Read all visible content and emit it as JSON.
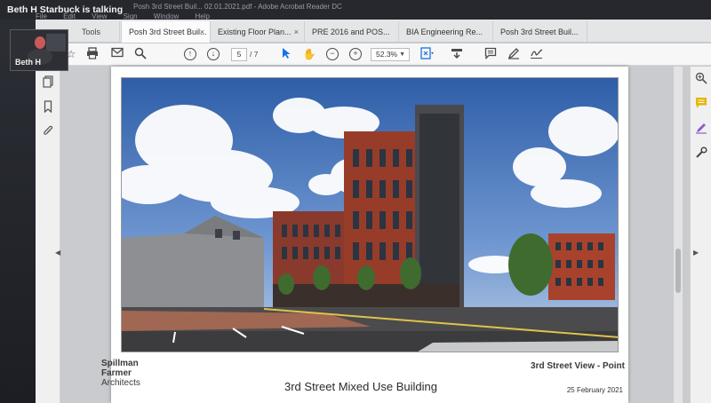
{
  "meeting": {
    "talking_label": "Beth H Starbuck is talking",
    "participant_name": "Beth H"
  },
  "window": {
    "title": "Posh 3rd Street Buil... 02.01.2021.pdf - Adobe Acrobat Reader DC",
    "menu": [
      "File",
      "Edit",
      "View",
      "Sign",
      "Window",
      "Help"
    ]
  },
  "tabs": {
    "tools": "Tools",
    "items": [
      {
        "label": "Posh 3rd Street Buil...",
        "active": true
      },
      {
        "label": "Existing Floor Plan...",
        "active": false
      },
      {
        "label": "PRE 2016 and POS...",
        "active": false
      },
      {
        "label": "BIA Engineering Re...",
        "active": false
      },
      {
        "label": "Posh 3rd Street Buil...",
        "active": false
      }
    ],
    "close_glyph": "×"
  },
  "toolbar": {
    "current_page": "5",
    "page_count": "/ 7",
    "zoom": "52.3%",
    "icons": [
      "star-icon",
      "print-icon",
      "mail-icon",
      "search-icon",
      "page-up-icon",
      "page-down-icon",
      "select-cursor-icon",
      "hand-icon",
      "zoom-out-icon",
      "zoom-in-icon",
      "fit-page-icon",
      "scroll-mode-icon",
      "comment-icon",
      "highlight-pen-icon",
      "sign-icon"
    ]
  },
  "left_panel": {
    "icons": [
      "pages-icon",
      "bookmark-icon",
      "attachment-icon"
    ]
  },
  "right_panel": {
    "icons": [
      "zoom-search-icon",
      "comment-panel-icon",
      "edit-pdf-icon",
      "tools-more-icon"
    ]
  },
  "document": {
    "firm_lines": [
      "Spillman",
      "Farmer",
      "Architects"
    ],
    "view_label": "3rd Street View - Point",
    "title": "3rd Street Mixed Use Building",
    "date": "25 February 2021"
  },
  "colors": {
    "accent_blue": "#1473e6",
    "comment_yellow": "#e8b500",
    "edit_purple": "#8d5ec8"
  }
}
